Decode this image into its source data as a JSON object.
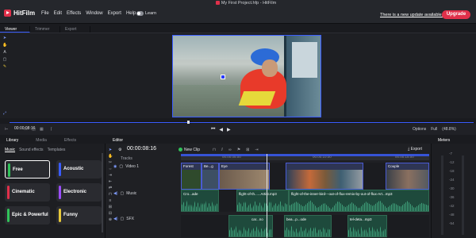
{
  "app": {
    "brand": "HitFilm",
    "window_title": "My First Project.hfp - HitFilm",
    "menu": [
      "File",
      "Edit",
      "Effects",
      "Window",
      "Export",
      "Help"
    ],
    "learn_label": "Learn",
    "update_link": "There is a new update available.",
    "upgrade_label": "Upgrade",
    "accent_color": "#e0304a"
  },
  "viewer": {
    "tabs": [
      "Viewer",
      "Trimmer",
      "Export"
    ],
    "timecode": "00:00:08:16",
    "options_label": "Options",
    "zoom_mode": "Full",
    "zoom_percent": "(48.8%)"
  },
  "library": {
    "tabs": [
      "Library",
      "Media",
      "Effects"
    ],
    "subtabs": [
      "Music",
      "Sound effects",
      "Templates"
    ],
    "cards": [
      {
        "label": "Free",
        "color": "#31c35a"
      },
      {
        "label": "Acoustic",
        "color": "#3a5cff"
      },
      {
        "label": "Cinematic",
        "color": "#e0304a"
      },
      {
        "label": "Electronic",
        "color": "#9b4dff"
      },
      {
        "label": "Epic & Powerful",
        "color": "#31c35a"
      },
      {
        "label": "Funny",
        "color": "#e6c83a"
      }
    ]
  },
  "editor": {
    "tab": "Editor",
    "timecode": "00:00:08:16",
    "new_clip_label": "New Clip",
    "export_label": "Export",
    "tracks_label": "Tracks",
    "ruler_ticks": [
      "00:00:05:00",
      "00:00:10:00",
      "00:00:15:00"
    ],
    "video_track": {
      "name": "Video 1",
      "clips": [
        "Forest",
        "Be...g",
        "Eye",
        "Couple"
      ]
    },
    "music_track": {
      "name": "Music",
      "clips": [
        "Cro...ade",
        "flight-of-th......Artist.mp3",
        "flight-of-the-inner-bird---out-of-flux-remix-by-out-of-flux-Art...mp3"
      ]
    },
    "sfx_track": {
      "name": "SFX",
      "clips": [
        "car...no",
        "bea...p...ode",
        "tel-deta...mp3"
      ]
    }
  },
  "meters": {
    "title": "Meters",
    "scale": [
      "-7",
      "-12",
      "-18",
      "-24",
      "-30",
      "-36",
      "-42",
      "-48",
      "-54"
    ]
  }
}
